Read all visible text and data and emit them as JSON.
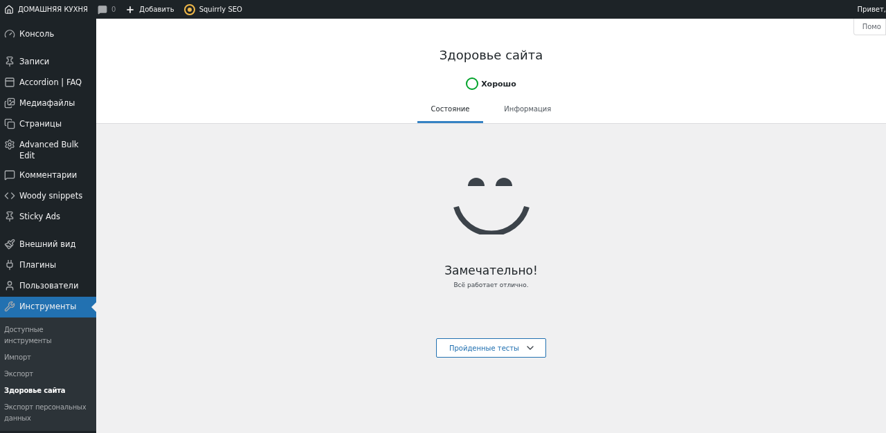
{
  "admin_bar": {
    "site": "ДОМАШНЯЯ КУХНЯ",
    "comments": "0",
    "add": "Добавить",
    "seo": "Squirrly SEO",
    "greeting": "Привет,"
  },
  "sidebar": {
    "groups": [
      [
        {
          "label": "Консоль",
          "selected": false
        }
      ],
      [
        {
          "label": "Записи",
          "selected": false
        },
        {
          "label": "Accordion | FAQ",
          "selected": false
        },
        {
          "label": "Медиафайлы",
          "selected": false
        },
        {
          "label": "Страницы",
          "selected": false
        },
        {
          "label": "Advanced Bulk Edit",
          "selected": false
        },
        {
          "label": "Комментарии",
          "selected": false
        },
        {
          "label": "Woody snippets",
          "selected": false
        },
        {
          "label": "Sticky Ads",
          "selected": false
        }
      ],
      [
        {
          "label": "Внешний вид",
          "selected": false
        },
        {
          "label": "Плагины",
          "selected": false
        },
        {
          "label": "Пользователи",
          "selected": false
        },
        {
          "label": "Инструменты",
          "selected": true,
          "children": [
            {
              "label": "Доступные инструменты",
              "selected": false
            },
            {
              "label": "Импорт",
              "selected": false
            },
            {
              "label": "Экспорт",
              "selected": false
            },
            {
              "label": "Здоровье сайта",
              "selected": true
            },
            {
              "label": "Экспорт персональных данных",
              "selected": false
            }
          ]
        }
      ]
    ]
  },
  "help_tab": "Помо",
  "header": {
    "title": "Здоровье сайта",
    "status": "Хорошо",
    "tabs": [
      {
        "label": "Состояние",
        "selected": true
      },
      {
        "label": "Информация",
        "selected": false
      }
    ]
  },
  "result": {
    "title": "Замечательно!",
    "text": "Всё работает отлично.",
    "button": "Пройденные тесты"
  }
}
